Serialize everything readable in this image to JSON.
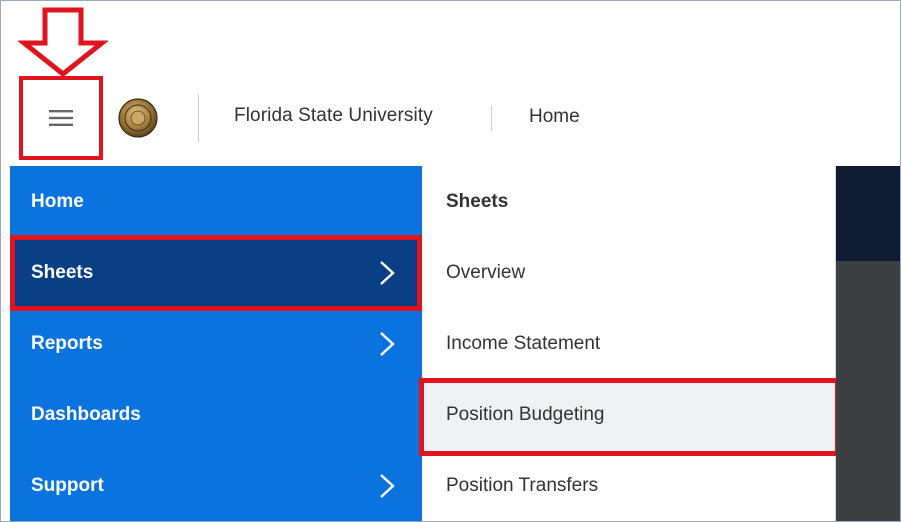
{
  "header": {
    "org_name": "Florida State University",
    "breadcrumb": "Home"
  },
  "annotations": {
    "highlight_color": "#e0141e"
  },
  "nav": {
    "bg_color": "#0b73dd",
    "active_color": "#0a3f86",
    "items": [
      {
        "label": "Home",
        "has_submenu": false,
        "active": false
      },
      {
        "label": "Sheets",
        "has_submenu": true,
        "active": true
      },
      {
        "label": "Reports",
        "has_submenu": true,
        "active": false
      },
      {
        "label": "Dashboards",
        "has_submenu": false,
        "active": false
      },
      {
        "label": "Support",
        "has_submenu": true,
        "active": false
      }
    ]
  },
  "submenu": {
    "title": "Sheets",
    "items": [
      {
        "label": "Overview",
        "selected": false
      },
      {
        "label": "Income Statement",
        "selected": false
      },
      {
        "label": "Position Budgeting",
        "selected": true
      },
      {
        "label": "Position Transfers",
        "selected": false
      }
    ]
  },
  "icons": {
    "menu": "hamburger-menu-icon",
    "seal": "university-seal-icon",
    "chevron": "chevron-right-icon",
    "arrow": "down-arrow-icon"
  }
}
